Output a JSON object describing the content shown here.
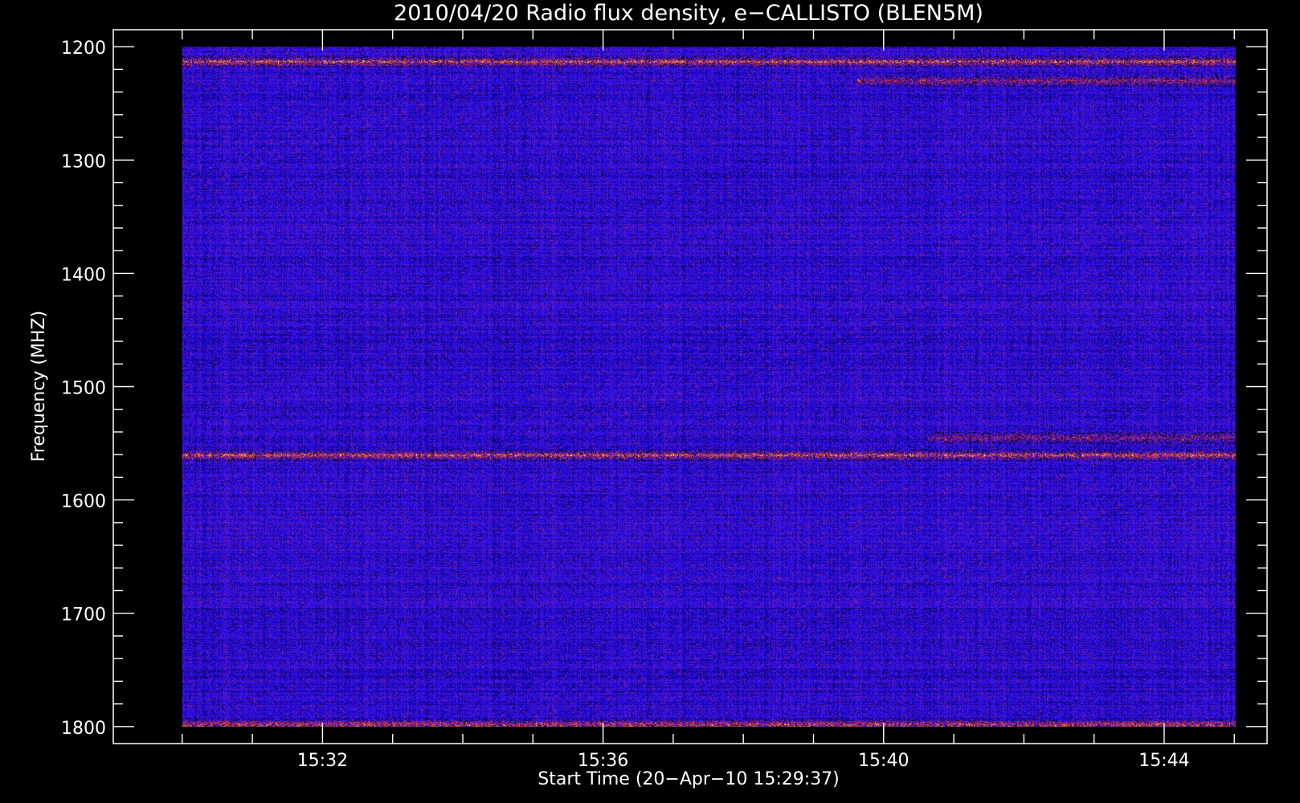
{
  "chart_data": {
    "type": "heatmap",
    "title": "2010/04/20  Radio flux density, e−CALLISTO (BLEN5M)",
    "xlabel": "Start Time (20−Apr−10 15:29:37)",
    "ylabel": "Frequency (MHZ)",
    "x_ticks": [
      {
        "label": "15:32",
        "minutes": 2.383
      },
      {
        "label": "15:36",
        "minutes": 6.383
      },
      {
        "label": "15:40",
        "minutes": 10.383
      },
      {
        "label": "15:44",
        "minutes": 14.383
      }
    ],
    "xlim_minutes_from_start": [
      -0.6,
      15.85
    ],
    "data_x_range_minutes_from_start": [
      0.383,
      15.4
    ],
    "y_ticks": [
      1200,
      1300,
      1400,
      1500,
      1600,
      1700,
      1800
    ],
    "ylim": [
      1185,
      1815
    ],
    "y_inverted": true,
    "data_y_range": [
      1200,
      1800
    ],
    "colormap": [
      "#000000",
      "#1e0aff",
      "#6a1fb0",
      "#d8202a",
      "#ff9a10",
      "#ffff70"
    ],
    "colors": {
      "background": "#000000",
      "axes": "#ffffff",
      "low": "#1e0aff",
      "high": "#ffff70"
    },
    "features": [
      {
        "name": "RFI band",
        "freq": 1213,
        "intensity": "high"
      },
      {
        "name": "RFI band",
        "freq": 1230,
        "intensity": "medium",
        "x_from": 10,
        "x_to": 15.4
      },
      {
        "name": "RFI band",
        "freq": 1545,
        "intensity": "medium",
        "x_from": 11,
        "x_to": 15.4
      },
      {
        "name": "RFI band",
        "freq": 1560,
        "intensity": "high"
      },
      {
        "name": "edge band",
        "freq": 1798,
        "intensity": "high"
      }
    ]
  }
}
